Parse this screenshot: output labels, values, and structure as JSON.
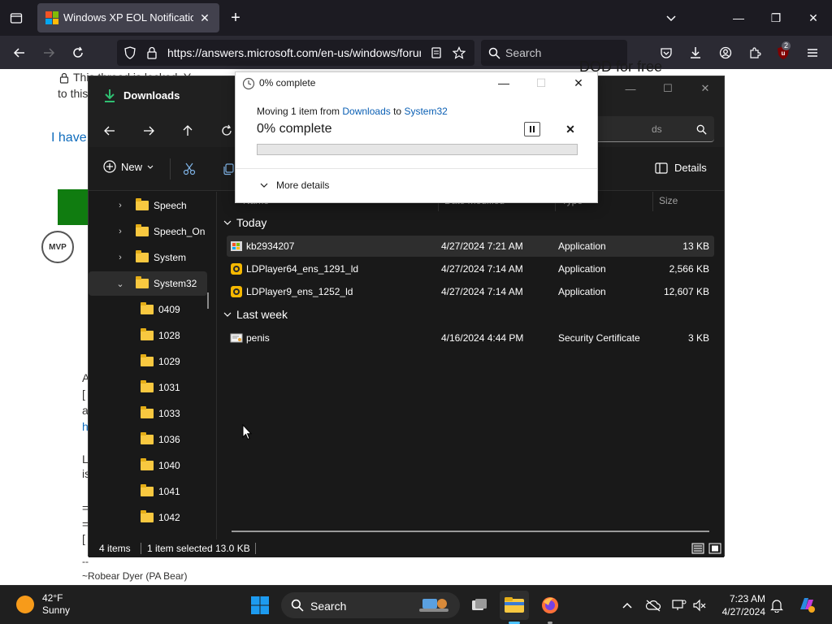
{
  "browser": {
    "tab_title": "Windows XP EOL Notification",
    "url": "https://answers.microsoft.com/en-us/windows/forum",
    "search_placeholder": "Search",
    "extension_badge": "2"
  },
  "webpage": {
    "top_line_1": "This thread is locked. Y",
    "top_line_2": "to this",
    "right_heading_fragment": "DOD for free",
    "have_link": "I have",
    "mvp_badge": "MVP",
    "signature_dashes": "--",
    "signature": "~Robear Dyer (PA Bear)",
    "left_fragments": [
      "A",
      "[",
      "a",
      "h",
      "L",
      "is",
      "=",
      "=",
      "["
    ]
  },
  "explorer": {
    "title": "Downloads",
    "search_placeholder": "ds",
    "toolbar": {
      "new_label": "New",
      "details_label": "Details"
    },
    "tree": [
      {
        "label": "Speech",
        "chevron": "›",
        "type": "collapsed"
      },
      {
        "label": "Speech_On",
        "chevron": "›",
        "type": "collapsed"
      },
      {
        "label": "System",
        "chevron": "›",
        "type": "collapsed"
      },
      {
        "label": "System32",
        "chevron": "⌄",
        "type": "expanded-selected"
      },
      {
        "label": "0409",
        "type": "child"
      },
      {
        "label": "1028",
        "type": "child"
      },
      {
        "label": "1029",
        "type": "child"
      },
      {
        "label": "1031",
        "type": "child"
      },
      {
        "label": "1033",
        "type": "child"
      },
      {
        "label": "1036",
        "type": "child"
      },
      {
        "label": "1040",
        "type": "child"
      },
      {
        "label": "1041",
        "type": "child"
      },
      {
        "label": "1042",
        "type": "child"
      }
    ],
    "columns": {
      "name": "Name",
      "date": "Date modified",
      "type": "Type",
      "size": "Size"
    },
    "groups": [
      {
        "label": "Today",
        "files": [
          {
            "name": "kb2934207",
            "date": "4/27/2024 7:21 AM",
            "type": "Application",
            "size": "13 KB",
            "selected": true,
            "icon": "windows-installer-icon"
          },
          {
            "name": "LDPlayer64_ens_1291_ld",
            "date": "4/27/2024 7:14 AM",
            "type": "Application",
            "size": "2,566 KB",
            "selected": false,
            "icon": "ldplayer-icon"
          },
          {
            "name": "LDPlayer9_ens_1252_ld",
            "date": "4/27/2024 7:14 AM",
            "type": "Application",
            "size": "12,607 KB",
            "selected": false,
            "icon": "ldplayer-icon"
          }
        ]
      },
      {
        "label": "Last week",
        "files": [
          {
            "name": "penis",
            "date": "4/16/2024 4:44 PM",
            "type": "Security Certificate",
            "size": "3 KB",
            "selected": false,
            "icon": "certificate-icon"
          }
        ]
      }
    ],
    "status": {
      "items": "4 items",
      "selected": "1 item selected",
      "size": "13.0 KB"
    }
  },
  "progress_dialog": {
    "title": "0% complete",
    "moving_prefix": "Moving 1 item from",
    "source": "Downloads",
    "to_word": "to",
    "destination": "System32",
    "percent_text": "0% complete",
    "progress": 0,
    "more_details": "More details"
  },
  "taskbar": {
    "weather_temp": "42°F",
    "weather_cond": "Sunny",
    "search_label": "Search",
    "time": "7:23 AM",
    "date": "4/27/2024"
  }
}
